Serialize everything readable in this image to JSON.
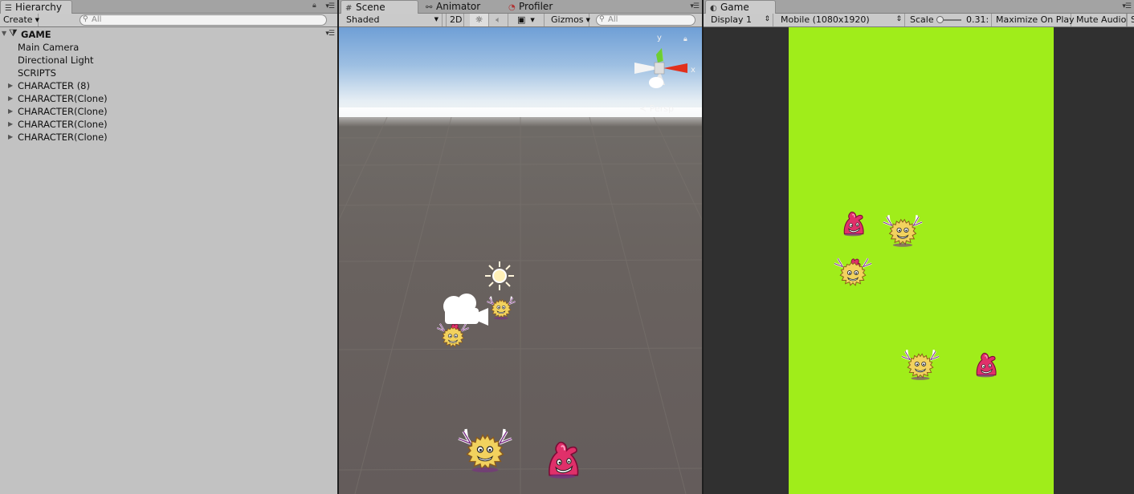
{
  "hierarchy": {
    "tab_label": "Hierarchy",
    "create_label": "Create",
    "search_placeholder": "All",
    "scene_name": "GAME",
    "items": [
      {
        "label": "Main Camera"
      },
      {
        "label": "Directional Light"
      },
      {
        "label": "SCRIPTS"
      },
      {
        "label": "CHARACTER (8)"
      },
      {
        "label": "CHARACTER(Clone)"
      },
      {
        "label": "CHARACTER(Clone)"
      },
      {
        "label": "CHARACTER(Clone)"
      },
      {
        "label": "CHARACTER(Clone)"
      }
    ]
  },
  "scene": {
    "tabs": [
      {
        "label": "Scene"
      },
      {
        "label": "Animator"
      },
      {
        "label": "Profiler"
      }
    ],
    "toolbar": {
      "shading_mode": "Shaded",
      "mode_2d": "2D",
      "gizmos_label": "Gizmos",
      "search_placeholder": "All"
    },
    "gizmo": {
      "y_label": "y",
      "x_label": "x",
      "projection": "Persp"
    }
  },
  "game": {
    "tab_label": "Game",
    "toolbar": {
      "display": "Display 1",
      "resolution": "Mobile (1080x1920)",
      "scale_label": "Scale",
      "scale_value": "0.31:",
      "maximize_label": "Maximize On Play",
      "mute_label": "Mute Audio",
      "stats_label": "S"
    }
  },
  "colors": {
    "game_background": "#a0ed1a",
    "editor_panel": "#c2c2c2",
    "pink_character": "#e0306a",
    "yellow_character": "#f2d25e"
  }
}
